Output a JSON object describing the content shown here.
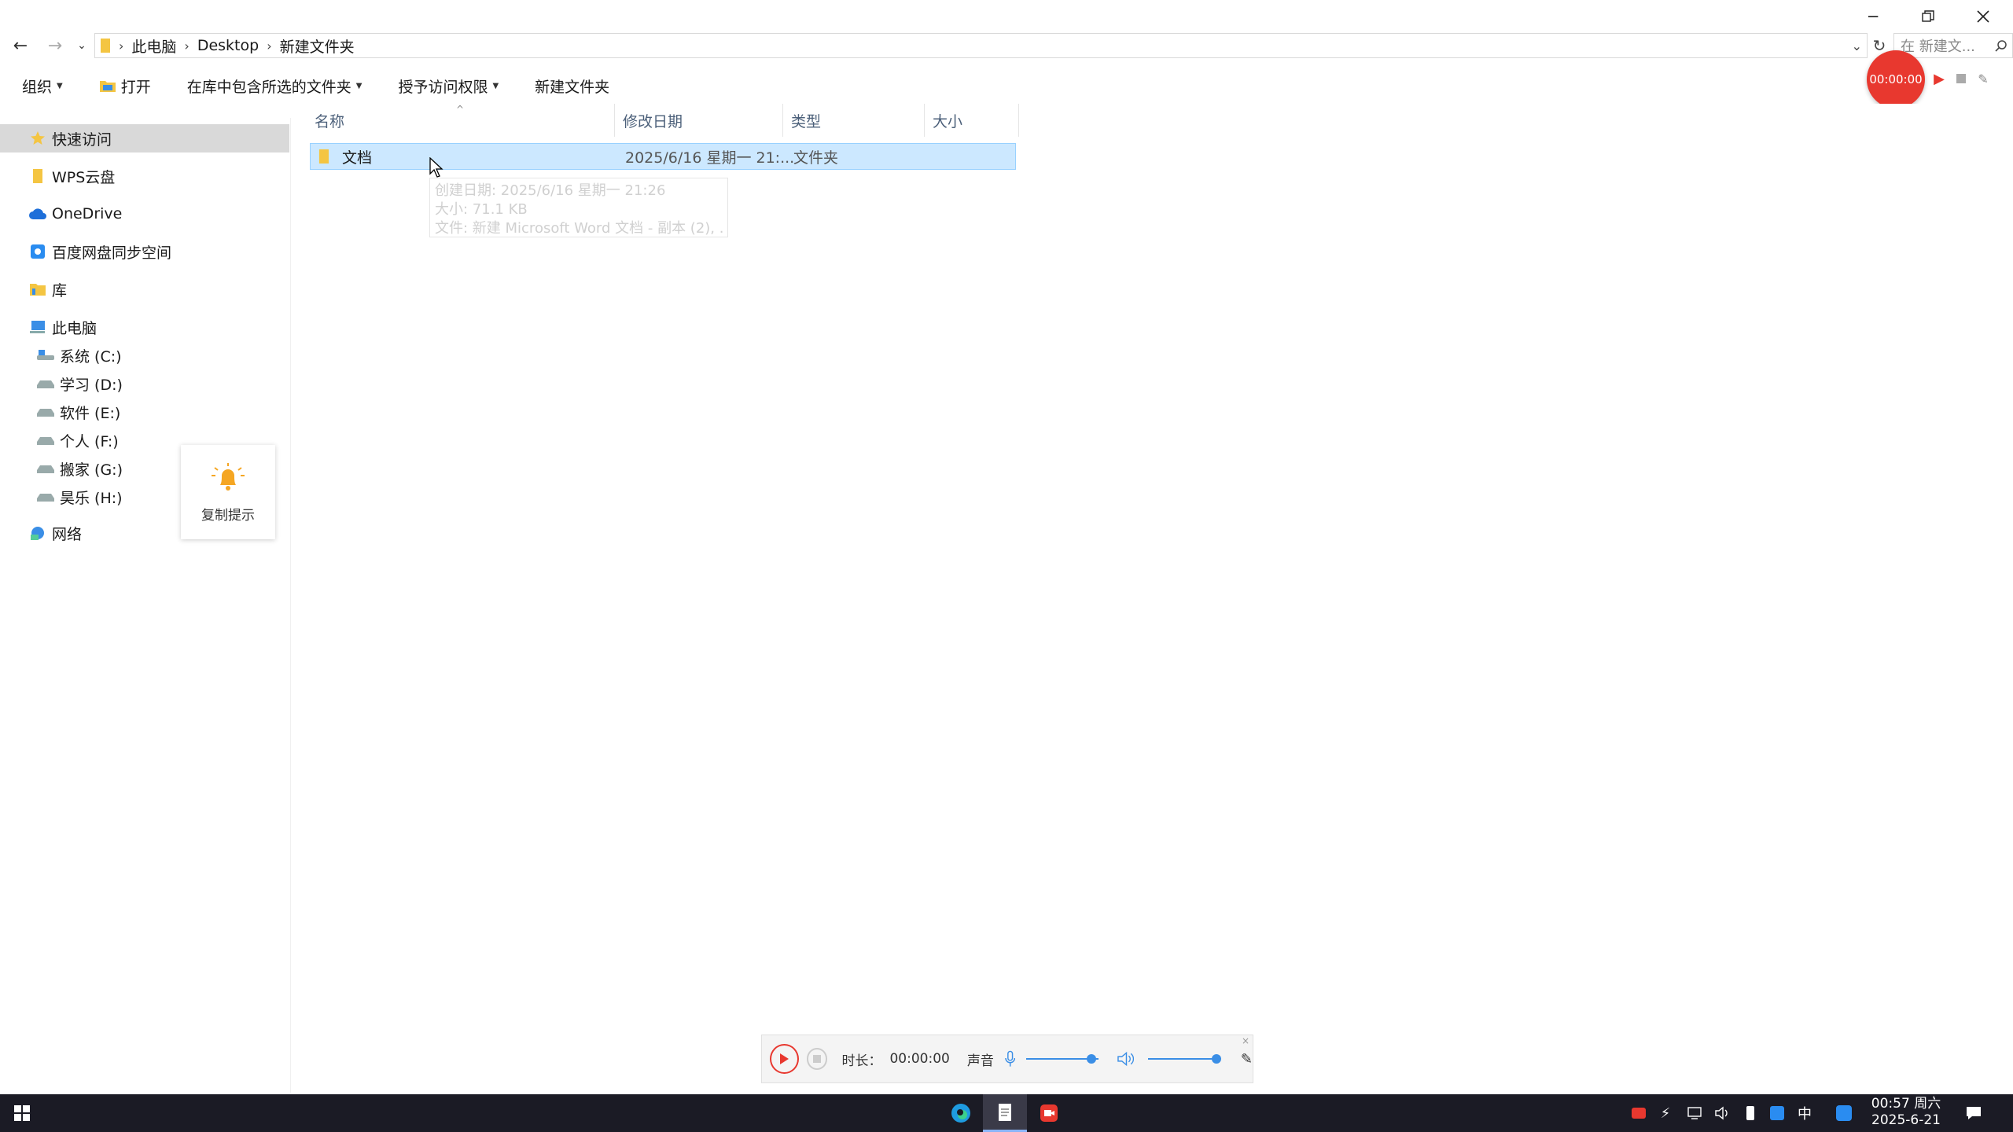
{
  "window": {
    "minimize_icon": "minimize-icon",
    "restore_icon": "restore-icon",
    "close_icon": "close-icon"
  },
  "address": {
    "breadcrumbs": [
      "此电脑",
      "Desktop",
      "新建文件夹"
    ],
    "search_placeholder": "在 新建文..."
  },
  "toolbar": {
    "organize": "组织",
    "open": "打开",
    "include_in_library": "在库中包含所选的文件夹",
    "grant_access": "授予访问权限",
    "new_folder": "新建文件夹"
  },
  "recorder_float": {
    "time": "00:00:00"
  },
  "nav": {
    "quick_access": "快速访问",
    "wps_cloud": "WPS云盘",
    "onedrive": "OneDrive",
    "baidu": "百度网盘同步空间",
    "library": "库",
    "this_pc": "此电脑",
    "drives": [
      "系统 (C:)",
      "学习 (D:)",
      "软件 (E:)",
      "个人 (F:)",
      "搬家 (G:)",
      "昊乐 (H:)"
    ],
    "network": "网络"
  },
  "columns": {
    "name": "名称",
    "modified": "修改日期",
    "type": "类型",
    "size": "大小"
  },
  "files": [
    {
      "name": "文档",
      "modified": "2025/6/16 星期一 21:...",
      "type": "文件夹",
      "size": ""
    }
  ],
  "tooltip": {
    "created": "创建日期: 2025/6/16 星期一 21:26",
    "size": "大小: 71.1 KB",
    "files": "文件: 新建 Microsoft Word 文档 - 副本 (2), ..."
  },
  "copy_hint": {
    "label": "复制提示"
  },
  "recorder_bar": {
    "duration_label": "时长：",
    "duration_value": "00:00:00",
    "sound_label": "声音",
    "mic_level": 0.9,
    "speaker_level": 0.95
  },
  "taskbar": {
    "time": "00:57 周六",
    "date": "2025-6-21",
    "ime": "中"
  },
  "colors": {
    "selection_bg": "#cce8ff",
    "selection_border": "#99d1ff",
    "record_red": "#e8382f",
    "taskbar_bg": "#1b1b25",
    "folder_yellow": "#f4c542"
  }
}
